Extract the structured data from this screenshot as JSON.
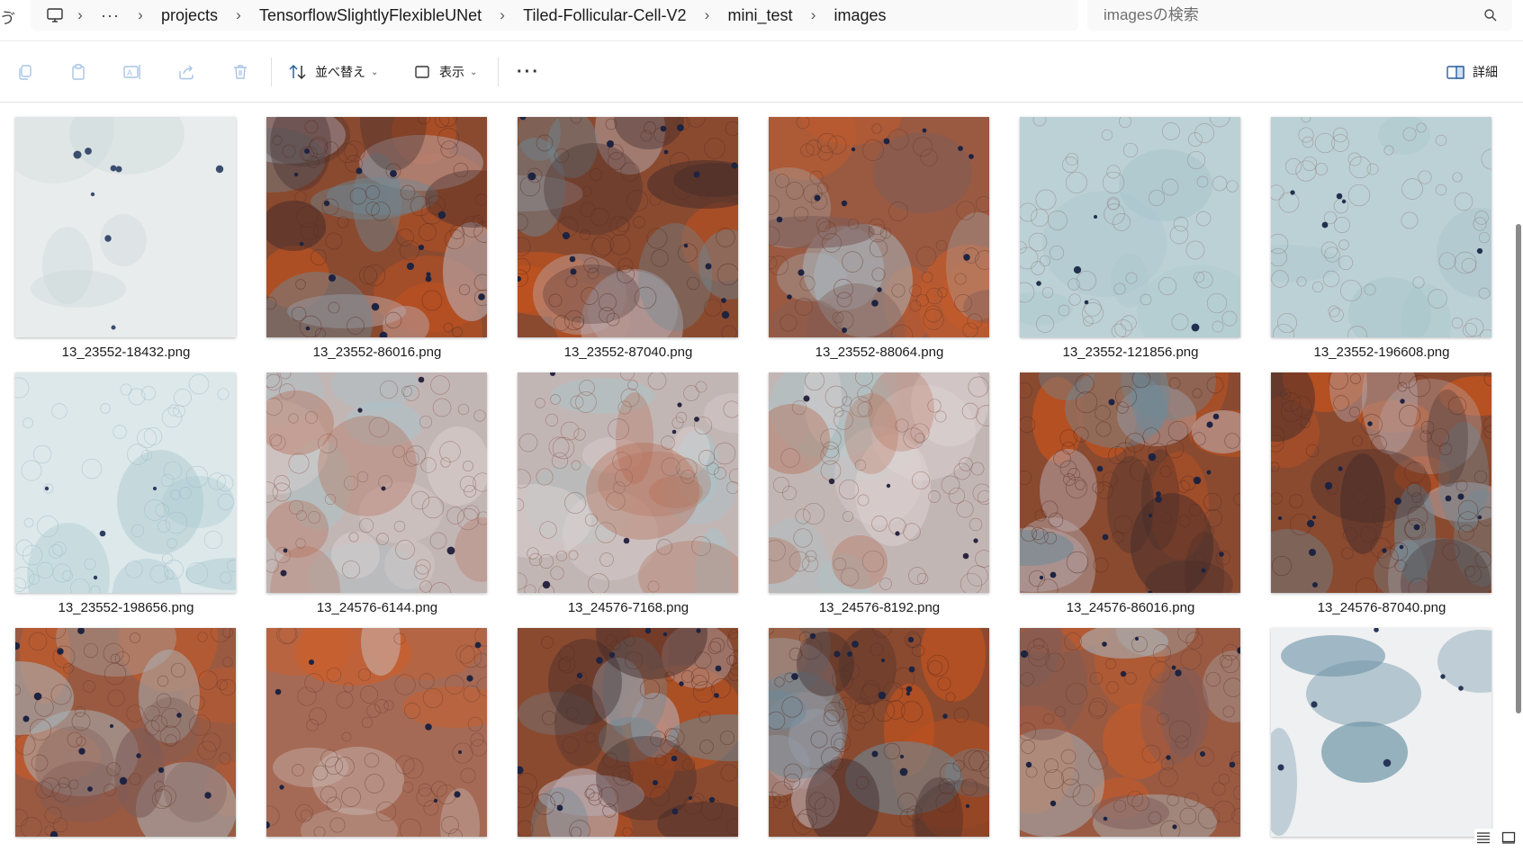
{
  "breadcrumb": {
    "items": [
      "projects",
      "TensorflowSlightlyFlexibleUNet",
      "Tiled-Follicular-Cell-V2",
      "mini_test",
      "images"
    ],
    "more": "···",
    "left_edge_glyph": "ゔ"
  },
  "search": {
    "placeholder": "imagesの検索",
    "value": ""
  },
  "toolbar": {
    "sort_label": "並べ替え",
    "view_label": "表示",
    "more_label": "···",
    "details_label": "詳細",
    "icons": [
      "copy-icon",
      "paste-icon",
      "rename-icon",
      "share-icon",
      "delete-icon",
      "sort-icon",
      "view-icon",
      "more-icon",
      "details-pane-icon"
    ]
  },
  "files": [
    {
      "name": "13_23552-18432.png",
      "style": "pale"
    },
    {
      "name": "13_23552-86016.png",
      "style": "red-dark"
    },
    {
      "name": "13_23552-87040.png",
      "style": "red-dark"
    },
    {
      "name": "13_23552-88064.png",
      "style": "red-mix"
    },
    {
      "name": "13_23552-121856.png",
      "style": "blue-mesh"
    },
    {
      "name": "13_23552-196608.png",
      "style": "blue-mesh"
    },
    {
      "name": "13_23552-198656.png",
      "style": "pale-blue"
    },
    {
      "name": "13_24576-6144.png",
      "style": "mesh-mix"
    },
    {
      "name": "13_24576-7168.png",
      "style": "mesh-mix"
    },
    {
      "name": "13_24576-8192.png",
      "style": "mesh-mix"
    },
    {
      "name": "13_24576-86016.png",
      "style": "red-dark"
    },
    {
      "name": "13_24576-87040.png",
      "style": "red-dark"
    },
    {
      "name": "",
      "style": "red-mix"
    },
    {
      "name": "",
      "style": "mesh-red"
    },
    {
      "name": "",
      "style": "red-dark"
    },
    {
      "name": "",
      "style": "red-dark"
    },
    {
      "name": "",
      "style": "red-mix"
    },
    {
      "name": "",
      "style": "pale-edge"
    }
  ],
  "status_icons": [
    "details-view-icon",
    "large-icons-view-icon"
  ]
}
